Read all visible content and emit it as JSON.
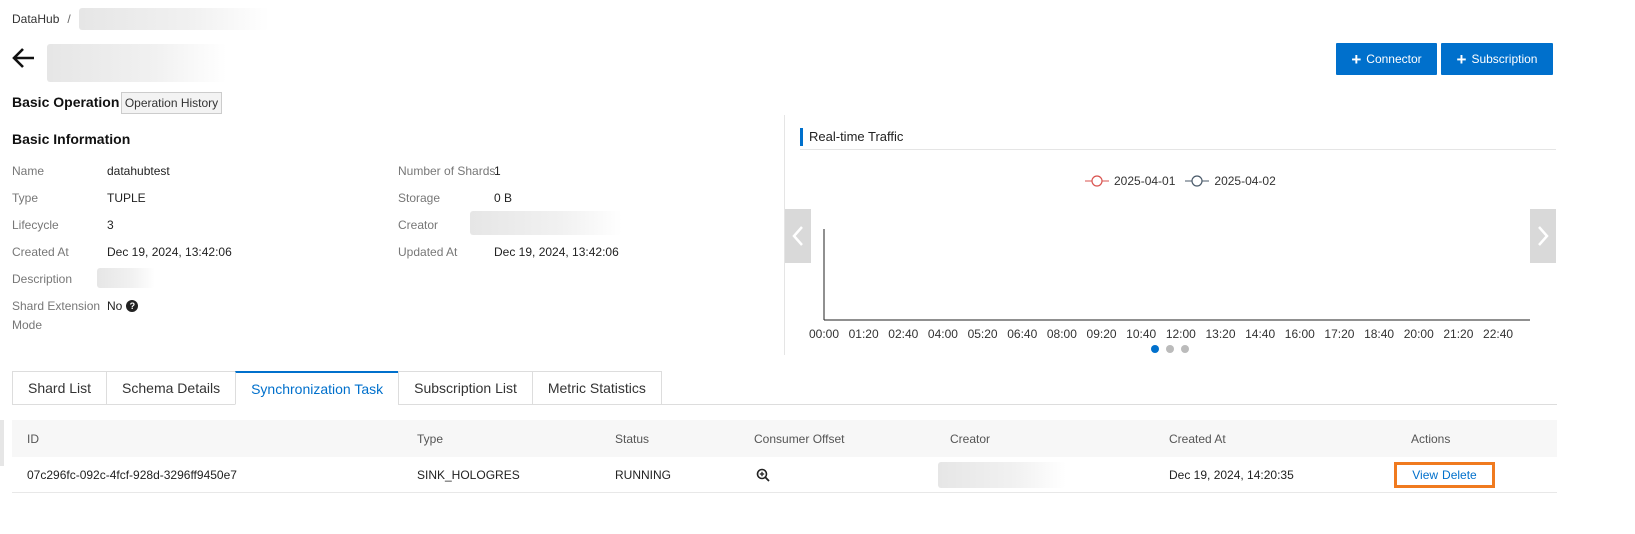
{
  "breadcrumb": {
    "root": "DataHub",
    "separator": "/"
  },
  "header": {
    "connector_button": "Connector",
    "subscription_button": "Subscription"
  },
  "basic_operation": {
    "title": "Basic Operation",
    "history_button": "Operation History"
  },
  "basic_info": {
    "title": "Basic Information",
    "name_label": "Name",
    "name_value": "datahubtest",
    "type_label": "Type",
    "type_value": "TUPLE",
    "lifecycle_label": "Lifecycle",
    "lifecycle_value": "3",
    "created_label": "Created At",
    "created_value": "Dec 19, 2024, 13:42:06",
    "description_label": "Description",
    "shard_ext_label_1": "Shard Extension",
    "shard_ext_label_2": "Mode",
    "shard_ext_value": "No",
    "shards_label": "Number of Shards",
    "shards_value": "1",
    "storage_label": "Storage",
    "storage_value": "0 B",
    "creator_label": "Creator",
    "updated_label": "Updated At",
    "updated_value": "Dec 19, 2024, 13:42:06"
  },
  "traffic": {
    "title": "Real-time Traffic",
    "legend": [
      {
        "label": "2025-04-01",
        "color": "#d9534f"
      },
      {
        "label": "2025-04-02",
        "color": "#4a5a6a"
      }
    ],
    "x_ticks": [
      "00:00",
      "01:20",
      "02:40",
      "04:00",
      "05:20",
      "06:40",
      "08:00",
      "09:20",
      "10:40",
      "12:00",
      "13:20",
      "14:40",
      "16:00",
      "17:20",
      "18:40",
      "20:00",
      "21:20",
      "22:40"
    ],
    "page_count": 3,
    "active_page": 1
  },
  "tabs": [
    "Shard List",
    "Schema Details",
    "Synchronization Task",
    "Subscription List",
    "Metric Statistics"
  ],
  "active_tab": "Synchronization Task",
  "table": {
    "headers": {
      "id": "ID",
      "type": "Type",
      "status": "Status",
      "offset": "Consumer Offset",
      "creator": "Creator",
      "created": "Created At",
      "actions": "Actions"
    },
    "row": {
      "id": "07c296fc-092c-4fcf-928d-3296ff9450e7",
      "type": "SINK_HOLOGRES",
      "status": "RUNNING",
      "created": "Dec 19, 2024, 14:20:35",
      "view": "View",
      "delete": "Delete"
    }
  },
  "colors": {
    "primary": "#0070cc",
    "highlight": "#f07a1f"
  }
}
